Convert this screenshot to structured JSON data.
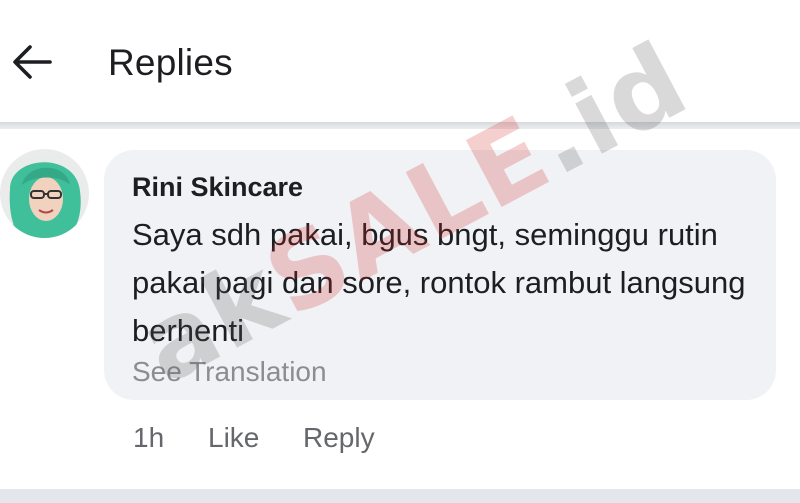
{
  "header": {
    "title": "Replies",
    "back_icon": "arrow-left-icon"
  },
  "comment": {
    "avatar_icon": "user-avatar",
    "author": "Rini Skincare",
    "text": "Saya sdh pakai, bgus bngt, seminggu rutin pakai pagi dan sore, rontok rambut langsung berhenti",
    "see_translation": "See Translation",
    "time": "1h",
    "like_label": "Like",
    "reply_label": "Reply"
  },
  "watermark": {
    "part1": "ak",
    "part2": "SALE",
    "part3": ".id"
  },
  "colors": {
    "bubble": "#f0f2f5",
    "secondary_text": "#65676b",
    "watermark_red": "#d52525"
  }
}
